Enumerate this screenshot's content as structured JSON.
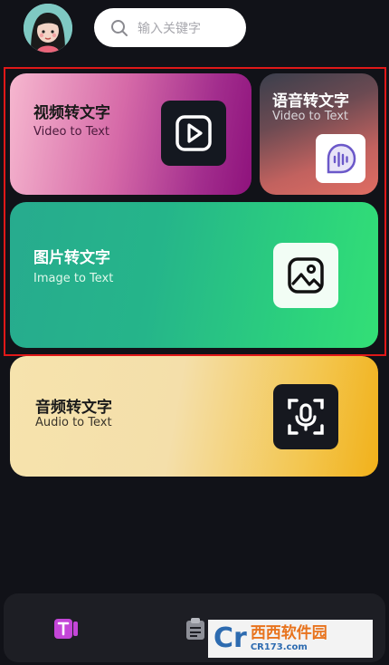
{
  "search": {
    "placeholder": "输入关键字"
  },
  "cards": {
    "video": {
      "title": "视频转文字",
      "subtitle": "Video to Text"
    },
    "voice": {
      "title": "语音转文字",
      "subtitle": "Video to Text"
    },
    "image": {
      "title": "图片转文字",
      "subtitle": "Image to Text"
    },
    "audio": {
      "title": "音频转文字",
      "subtitle": "Audio to Text"
    }
  },
  "watermark": {
    "logo": "Cr",
    "brand": "西西软件园",
    "site": "CR173.com"
  },
  "colors": {
    "background": "#111218",
    "highlight": "#e01818"
  }
}
